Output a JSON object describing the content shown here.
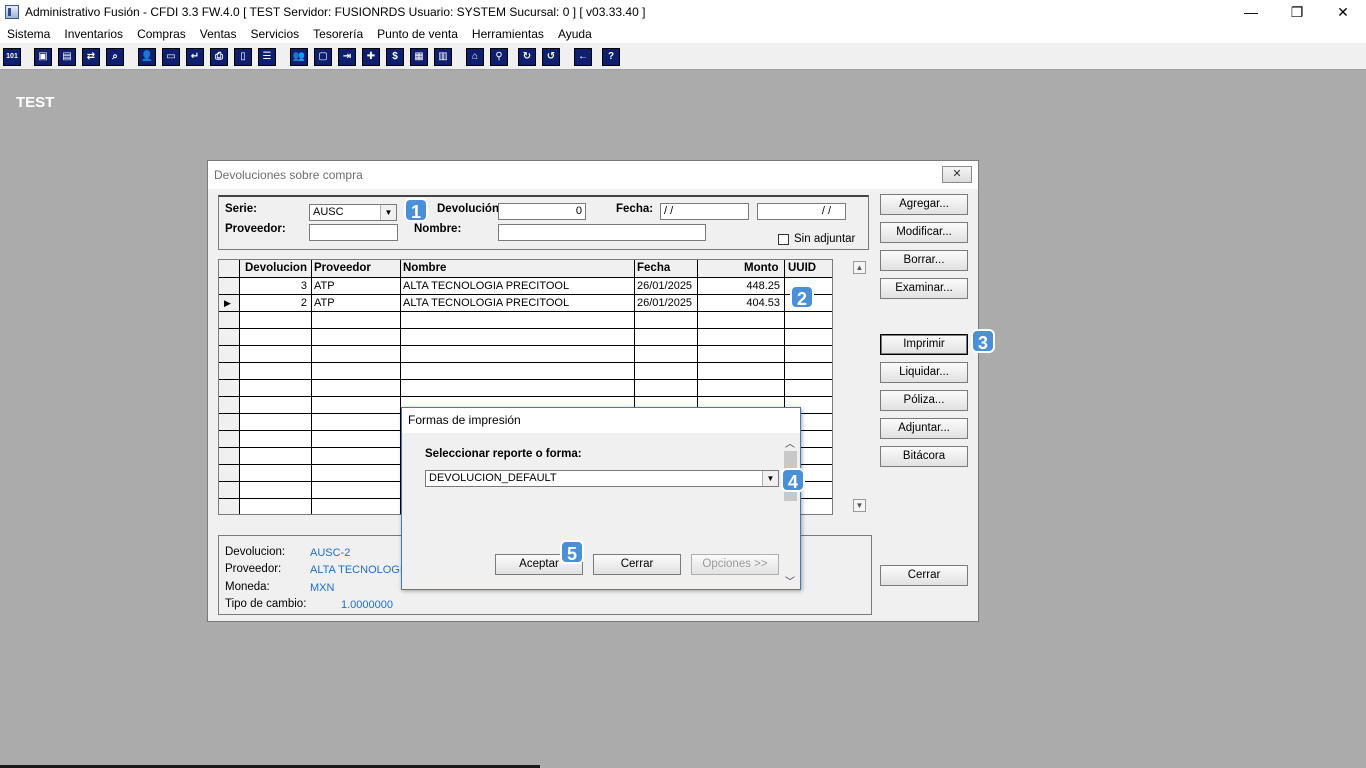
{
  "window": {
    "title": "Administrativo Fusión - CFDI 3.3 FW.4.0 [ TEST  Servidor: FUSIONRDS   Usuario: SYSTEM    Sucursal: 0 ] [ v03.33.40 ]",
    "minimize": "—",
    "restore": "❐",
    "close": "✕"
  },
  "menu": [
    "Sistema",
    "Inventarios",
    "Compras",
    "Ventas",
    "Servicios",
    "Tesorería",
    "Punto de venta",
    "Herramientas",
    "Ayuda"
  ],
  "toolbar": {
    "buttons": [
      {
        "name": "calendar-icon",
        "glyph": "101"
      },
      {
        "name": "copy-icon",
        "glyph": "▣"
      },
      {
        "name": "clipboard-icon",
        "glyph": "▤"
      },
      {
        "name": "transfer-icon",
        "glyph": "⇄"
      },
      {
        "name": "search-doc-icon",
        "glyph": "⌕"
      },
      {
        "name": "user-icon",
        "glyph": "👤"
      },
      {
        "name": "folder-icon",
        "glyph": "▭"
      },
      {
        "name": "import-icon",
        "glyph": "↵"
      },
      {
        "name": "print-icon",
        "glyph": "⎙"
      },
      {
        "name": "document-icon",
        "glyph": "▯"
      },
      {
        "name": "list-icon",
        "glyph": "☰"
      },
      {
        "name": "people-icon",
        "glyph": "👥"
      },
      {
        "name": "box-icon",
        "glyph": "▢"
      },
      {
        "name": "export-icon",
        "glyph": "⇥"
      },
      {
        "name": "add-icon",
        "glyph": "✚"
      },
      {
        "name": "money-icon",
        "glyph": "$"
      },
      {
        "name": "report-icon",
        "glyph": "▦"
      },
      {
        "name": "table-icon",
        "glyph": "▥"
      },
      {
        "name": "home-icon",
        "glyph": "⌂"
      },
      {
        "name": "zoom-icon",
        "glyph": "⚲"
      },
      {
        "name": "refresh-icon",
        "glyph": "↻"
      },
      {
        "name": "undo-icon",
        "glyph": "↺"
      },
      {
        "name": "back-icon",
        "glyph": "←"
      },
      {
        "name": "help-icon",
        "glyph": "?"
      }
    ]
  },
  "workspace": {
    "label": "TEST"
  },
  "dialog": {
    "title": "Devoluciones sobre compra",
    "close": "✕",
    "filters": {
      "serie_label": "Serie:",
      "serie_value": "AUSC",
      "devolucion_label": "Devolución:",
      "devolucion_value": "0",
      "fecha_label": "Fecha:",
      "fecha_from": " / /",
      "fecha_to": "/ /",
      "proveedor_label": "Proveedor:",
      "proveedor_value": "",
      "nombre_label": "Nombre:",
      "nombre_value": "",
      "sin_adjuntar_label": "Sin adjuntar"
    },
    "grid": {
      "headers": [
        "Devolucion",
        "Proveedor",
        "Nombre",
        "Fecha",
        "Monto",
        "UUID"
      ],
      "rows": [
        {
          "devolucion": "3",
          "proveedor": "ATP",
          "nombre": "ALTA TECNOLOGIA PRECITOOL",
          "fecha": "26/01/2025",
          "monto": "448.25",
          "uuid": "",
          "current": false
        },
        {
          "devolucion": "2",
          "proveedor": "ATP",
          "nombre": "ALTA TECNOLOGIA PRECITOOL",
          "fecha": "26/01/2025",
          "monto": "404.53",
          "uuid": "",
          "current": true
        }
      ],
      "current_marker": "▶"
    },
    "buttons": {
      "agregar": "Agregar...",
      "modificar": "Modificar...",
      "borrar": "Borrar...",
      "examinar": "Examinar...",
      "imprimir": "Imprimir",
      "liquidar": "Liquidar...",
      "poliza": "Póliza...",
      "adjuntar": "Adjuntar...",
      "bitacora": "Bitácora",
      "cerrar": "Cerrar"
    },
    "detail": {
      "devolucion_label": "Devolucion:",
      "devolucion_value": "AUSC-2",
      "proveedor_label": "Proveedor:",
      "proveedor_value": "ALTA TECNOLOGIA",
      "moneda_label": "Moneda:",
      "moneda_value": "MXN",
      "tipo_cambio_label": "Tipo de cambio:",
      "tipo_cambio_value": "1.0000000"
    }
  },
  "print_dialog": {
    "title": "Formas de impresión",
    "select_label": "Seleccionar reporte o forma:",
    "select_value": "DEVOLUCION_DEFAULT",
    "aceptar": "Aceptar",
    "cerrar": "Cerrar",
    "opciones": "Opciones >>"
  },
  "badges": [
    "1",
    "2",
    "3",
    "4",
    "5"
  ],
  "colors": {
    "workspace": "#ababab",
    "badge": "#4a90d8",
    "toolbar_button": "#0d1f6e",
    "detail_value": "#1e6fc8"
  }
}
